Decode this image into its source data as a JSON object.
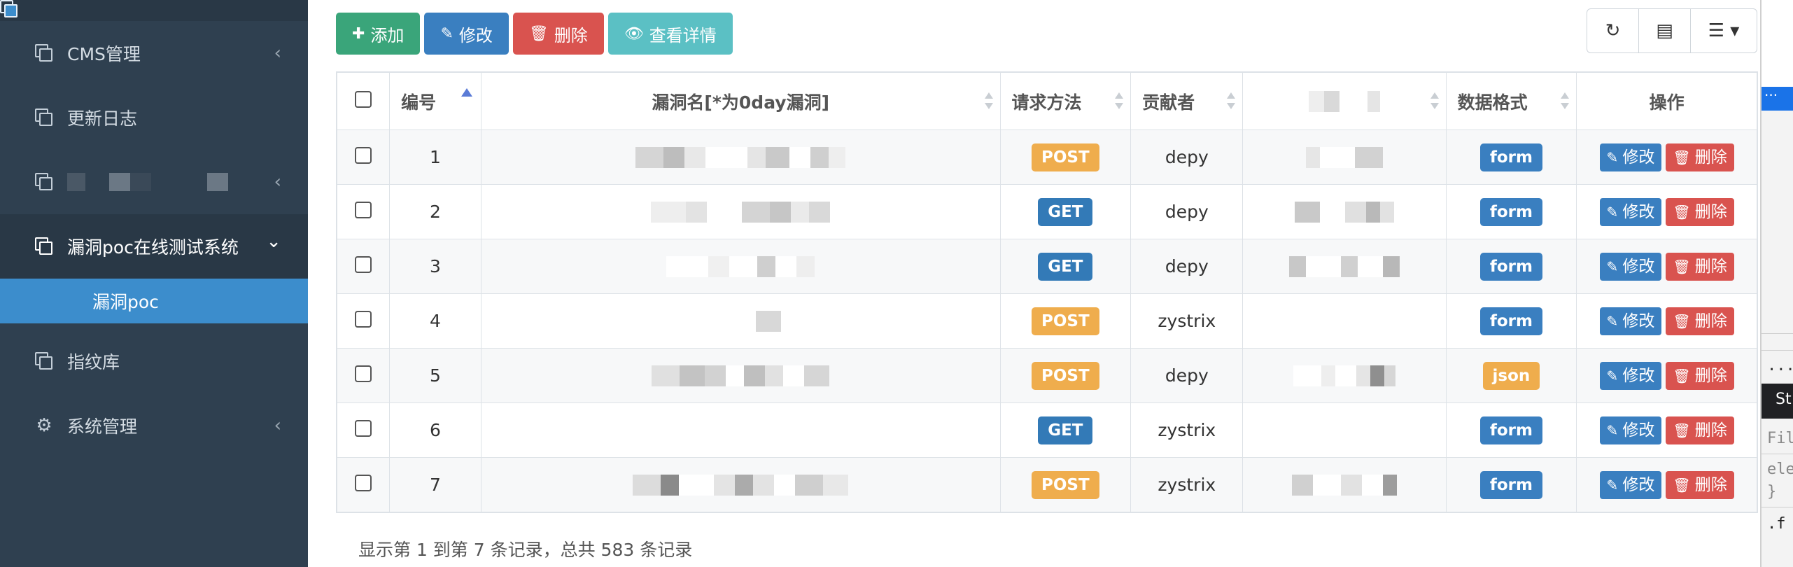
{
  "sidebar": {
    "items": [
      {
        "label": "CMS管理",
        "icon": "copy-icon",
        "chevron": "‹"
      },
      {
        "label": "更新日志",
        "icon": "copy-icon",
        "chevron": ""
      },
      {
        "label": "",
        "icon": "copy-icon",
        "chevron": "‹"
      },
      {
        "label": "漏洞poc在线测试系统",
        "icon": "copy-icon",
        "chevron": "⌄"
      },
      {
        "label": "漏洞poc",
        "icon": "copy-icon"
      },
      {
        "label": "指纹库",
        "icon": "copy-icon",
        "chevron": ""
      },
      {
        "label": "系统管理",
        "icon": "cogs-icon",
        "chevron": "‹"
      }
    ]
  },
  "toolbar": {
    "add": "添加",
    "edit": "修改",
    "delete": "删除",
    "detail": "查看详情"
  },
  "table": {
    "headers": {
      "id": "编号",
      "name": "漏洞名[*为0day漏洞]",
      "method": "请求方法",
      "author": "贡献者",
      "format": "数据格式",
      "ops": "操作"
    },
    "edit_label": "修改",
    "delete_label": "删除",
    "rows": [
      {
        "id": "1",
        "method": "POST",
        "author": "depy",
        "format": "form"
      },
      {
        "id": "2",
        "method": "GET",
        "author": "depy",
        "format": "form"
      },
      {
        "id": "3",
        "method": "GET",
        "author": "depy",
        "format": "form"
      },
      {
        "id": "4",
        "method": "POST",
        "author": "zystrix",
        "format": "form"
      },
      {
        "id": "5",
        "method": "POST",
        "author": "depy",
        "format": "json"
      },
      {
        "id": "6",
        "method": "GET",
        "author": "zystrix",
        "format": "form"
      },
      {
        "id": "7",
        "method": "POST",
        "author": "zystrix",
        "format": "form"
      }
    ]
  },
  "pagination": {
    "summary": "显示第 1 到第 7 条记录，总共 583 条记录"
  },
  "devtools": {
    "tab": "St",
    "filter": "Filt",
    "code1": "ele",
    "code2": "}",
    "code3": ".f"
  }
}
